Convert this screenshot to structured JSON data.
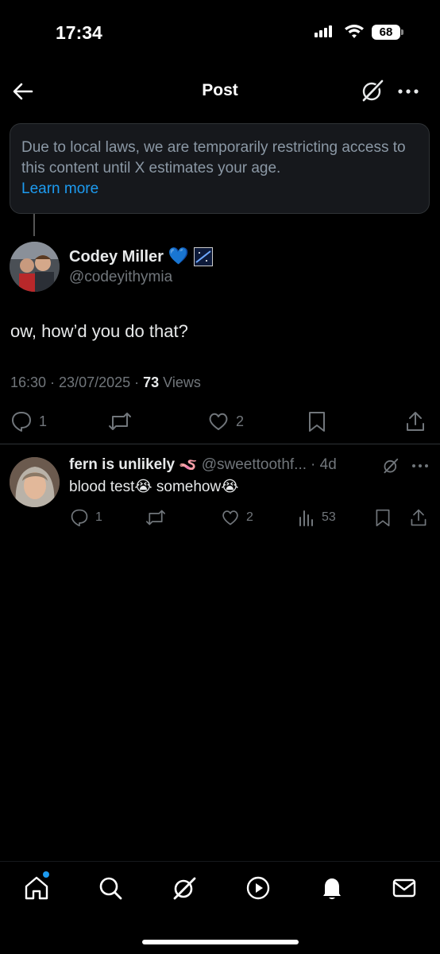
{
  "status_bar": {
    "time": "17:34",
    "battery": "68"
  },
  "header": {
    "title": "Post"
  },
  "notice": {
    "text": "Due to local laws, we are temporarily restricting access to this content until X estimates your age.",
    "link": "Learn more"
  },
  "post": {
    "author_name": "Codey Miller",
    "author_badge": "💙",
    "author_handle": "@codeyithymia",
    "text": "ow, how’d you do that?",
    "timestamp": "16:30 · 23/07/2025 · ",
    "views_count": "73",
    "views_label": " Views",
    "replies": "1",
    "likes": "2"
  },
  "reply": {
    "author_name": "fern is unlikely",
    "author_emoji": "🪱",
    "author_handle": "@sweettoothf...",
    "time_ago": "· 4d",
    "text": "blood test😭 somehow😭",
    "replies": "1",
    "likes": "2",
    "views": "53"
  },
  "colors": {
    "accent": "#1d9bf0",
    "secondary_text": "#71767b",
    "notice_bg": "#16181c"
  }
}
